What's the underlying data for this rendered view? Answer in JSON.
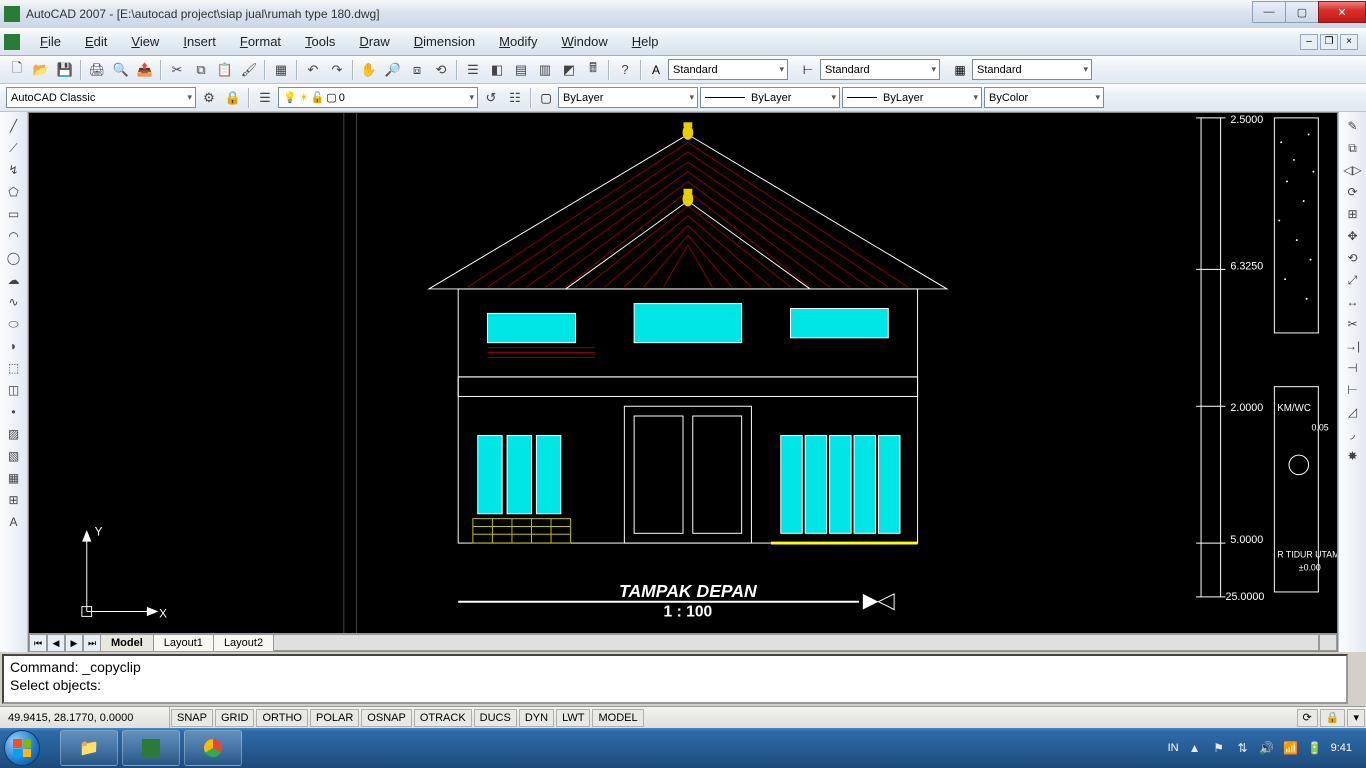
{
  "window": {
    "title": "AutoCAD 2007 - [E:\\autocad project\\siap jual\\rumah type 180.dwg]"
  },
  "menu": [
    "File",
    "Edit",
    "View",
    "Insert",
    "Format",
    "Tools",
    "Draw",
    "Dimension",
    "Modify",
    "Window",
    "Help"
  ],
  "workspace": {
    "combo": "AutoCAD Classic"
  },
  "layer": {
    "current": "0"
  },
  "styles": {
    "text": "Standard",
    "dim": "Standard",
    "table": "Standard"
  },
  "props": {
    "color": "ByLayer",
    "linetype": "ByLayer",
    "lineweight": "ByLayer",
    "plotstyle": "ByColor"
  },
  "tabs": [
    "Model",
    "Layout1",
    "Layout2"
  ],
  "cmd": {
    "line1": "Command: _copyclip",
    "line2": "Select objects:"
  },
  "status": {
    "coords": "49.9415, 28.1770, 0.0000",
    "toggles": [
      "SNAP",
      "GRID",
      "ORTHO",
      "POLAR",
      "OSNAP",
      "OTRACK",
      "DUCS",
      "DYN",
      "LWT",
      "MODEL"
    ]
  },
  "drawing": {
    "title": "TAMPAK DEPAN",
    "scale": "1 : 100",
    "dims": {
      "a": "2.5000",
      "b": "6.3250",
      "c": "2.0000",
      "d": "5.0000",
      "e": "25.0000",
      "f": "0.05",
      "g": "±0.00"
    },
    "labels": {
      "km": "KM/WC",
      "room": "R TIDUR UTAMA"
    }
  },
  "taskbar": {
    "lang": "IN",
    "time": "9:41"
  }
}
